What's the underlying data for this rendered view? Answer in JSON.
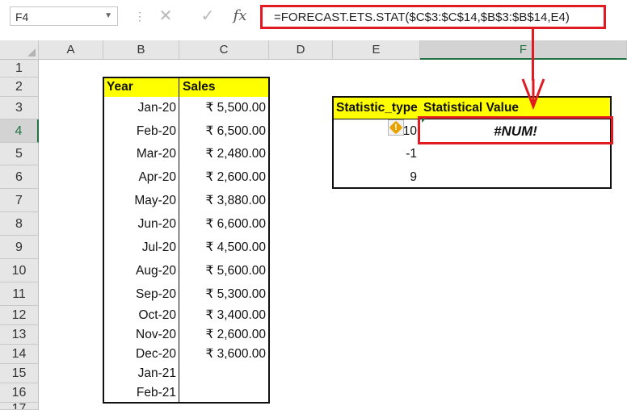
{
  "formula_bar": {
    "name_box": "F4",
    "cancel_icon": "✕",
    "enter_icon": "✓",
    "fx_label": "fx",
    "formula": "=FORECAST.ETS.STAT($C$3:$C$14,$B$3:$B$14,E4)"
  },
  "columns": [
    "A",
    "B",
    "C",
    "D",
    "E",
    "F"
  ],
  "rows": [
    "1",
    "2",
    "3",
    "4",
    "5",
    "6",
    "7",
    "8",
    "9",
    "10",
    "11",
    "12",
    "13",
    "14",
    "15",
    "16",
    "17"
  ],
  "table": {
    "year_header": "Year",
    "sales_header": "Sales",
    "years": [
      "Jan-20",
      "Feb-20",
      "Mar-20",
      "Apr-20",
      "May-20",
      "Jun-20",
      "Jul-20",
      "Aug-20",
      "Sep-20",
      "Oct-20",
      "Nov-20",
      "Dec-20",
      "Jan-21",
      "Feb-21"
    ],
    "sales": [
      "₹ 5,500.00",
      "₹ 6,500.00",
      "₹ 2,480.00",
      "₹ 2,600.00",
      "₹ 3,880.00",
      "₹ 6,600.00",
      "₹ 4,500.00",
      "₹ 5,600.00",
      "₹ 5,300.00",
      "₹ 3,400.00",
      "₹ 2,600.00",
      "₹ 3,600.00",
      "",
      ""
    ]
  },
  "stats": {
    "type_header": "Statistic_type",
    "value_header": "Statistical Value",
    "types": [
      "10",
      "-1",
      "9"
    ],
    "values": [
      "#NUM!",
      "",
      ""
    ]
  },
  "colors": {
    "accent": "#e21b23",
    "header_fill": "#ffff00",
    "excel_green": "#217346"
  }
}
